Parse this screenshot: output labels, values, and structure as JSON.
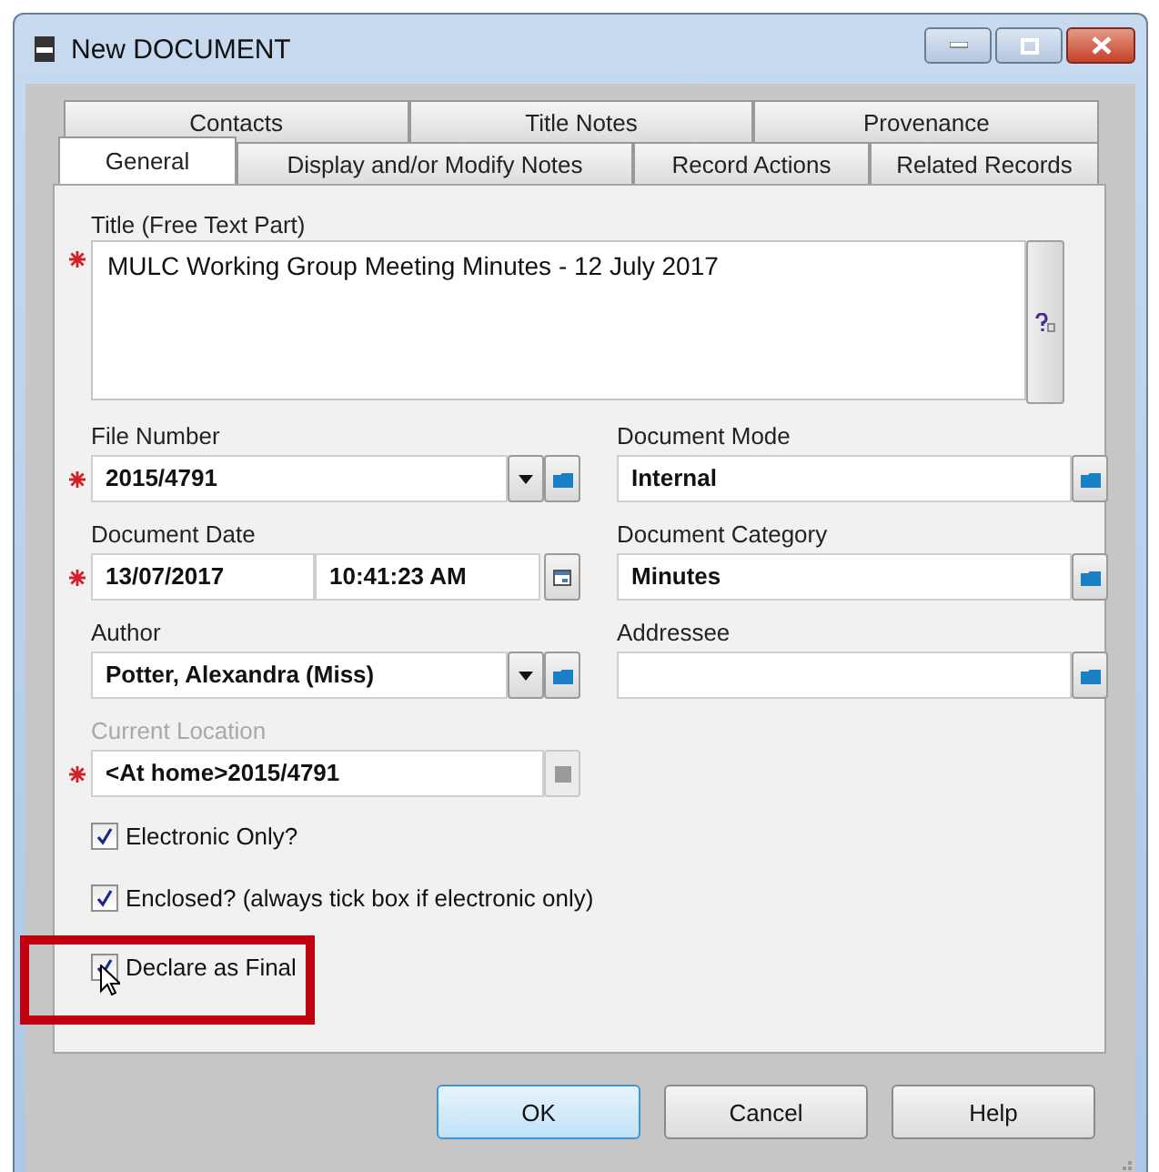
{
  "window": {
    "title": "New DOCUMENT"
  },
  "tab_rows": [
    [
      {
        "label": "Contacts",
        "selected": false
      },
      {
        "label": "Title Notes",
        "selected": false
      },
      {
        "label": "Provenance",
        "selected": false
      }
    ],
    [
      {
        "label": "General",
        "selected": true
      },
      {
        "label": "Display and/or Modify Notes",
        "selected": false
      },
      {
        "label": "Record Actions",
        "selected": false
      },
      {
        "label": "Related Records",
        "selected": false
      }
    ]
  ],
  "title_field": {
    "label": "Title (Free Text Part)",
    "value": "MULC Working Group Meeting Minutes - 12 July 2017",
    "required": true
  },
  "field_rows": [
    {
      "left": {
        "kind": "text",
        "label": "File Number",
        "value": "2015/4791",
        "required": true,
        "dropdown": true,
        "lookup": true
      },
      "right": {
        "kind": "text",
        "label": "Document Mode",
        "value": "Internal",
        "lookup": true
      }
    },
    {
      "left": {
        "kind": "date",
        "label": "Document Date",
        "value": "13/07/2017",
        "time": "10:41:23 AM",
        "required": true
      },
      "right": {
        "kind": "text",
        "label": "Document Category",
        "value": "Minutes",
        "lookup": true
      }
    },
    {
      "left": {
        "kind": "text",
        "label": "Author",
        "value": "Potter, Alexandra (Miss)",
        "dropdown": true,
        "lookup": true
      },
      "right": {
        "kind": "text",
        "label": "Addressee",
        "lookup": true
      }
    },
    {
      "left": {
        "kind": "location",
        "label": "Current Location",
        "label_disabled": true,
        "value": "<At home>2015/4791",
        "required": true
      }
    }
  ],
  "checkboxes": [
    {
      "label": "Electronic Only?",
      "checked": true,
      "highlighted": false
    },
    {
      "label": "Enclosed? (always tick box if electronic only)",
      "checked": true,
      "highlighted": false
    },
    {
      "label": "Declare as Final",
      "checked": true,
      "highlighted": true
    }
  ],
  "buttons": [
    {
      "label": "OK",
      "default": true
    },
    {
      "label": "Cancel",
      "default": false
    },
    {
      "label": "Help",
      "default": false
    }
  ]
}
